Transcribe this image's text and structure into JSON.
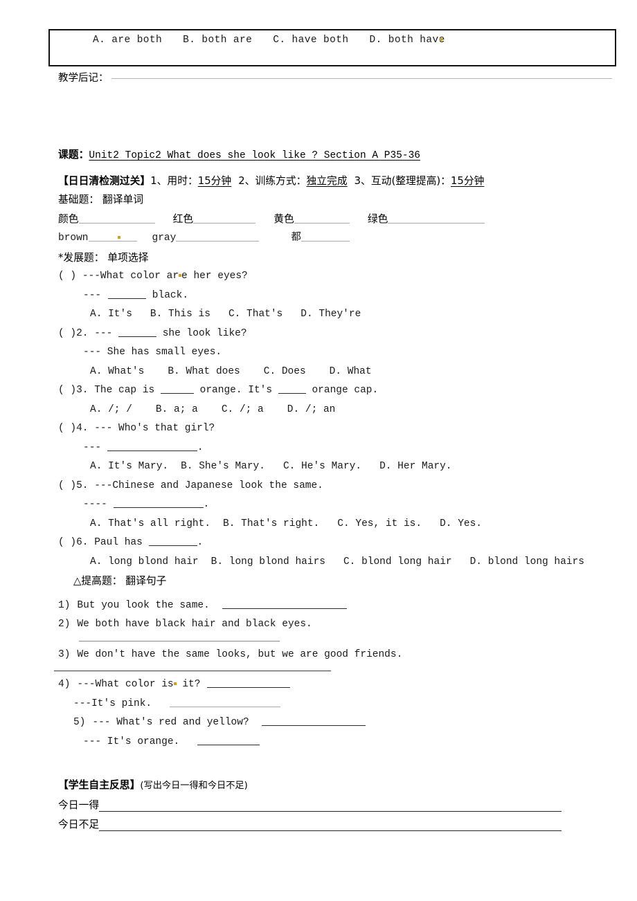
{
  "top_box": {
    "options": [
      "A. are both",
      "B. both are",
      "C. have both",
      "D. both have"
    ]
  },
  "teaching_note": {
    "label": "教学后记："
  },
  "lesson": {
    "title_label": "课题：",
    "title_value": "Unit2  Topic2   What does she look like  ?  Section A  P35-36"
  },
  "checkpoint": {
    "heading": "【日日清检测过关】",
    "item1_label": "1、用时：",
    "item1_value": "15分钟",
    "item2_label": "2、训练方式：",
    "item2_value": "独立完成",
    "item3_label": "3、互动(整理提高)：",
    "item3_value": "15分钟"
  },
  "basic": {
    "heading": "基础题：  翻译单词",
    "words_row1": [
      {
        "label": "颜色"
      },
      {
        "label": "红色"
      },
      {
        "label": "黄色"
      },
      {
        "label": "绿色"
      }
    ],
    "words_row2": [
      {
        "label": "brown"
      },
      {
        "label": "gray"
      },
      {
        "label": "都"
      }
    ]
  },
  "development": {
    "heading": "*发展题：  单项选择",
    "questions": [
      {
        "number": "(  ) ",
        "stem": "---What color ar",
        "stem_tail": "e her eyes?",
        "reply_prefix": "---",
        "reply_suffix": " black.",
        "options": [
          "A. It's",
          "B. This is",
          "C. That's",
          "D. They're"
        ]
      },
      {
        "number": "(  )2. ",
        "stem_prefix": "--- ",
        "stem_suffix": " she look like?",
        "reply": "--- She has small eyes.",
        "options": [
          "A. What's",
          "B. What does",
          "C. Does",
          "D. What"
        ]
      },
      {
        "number": "(  )3. ",
        "stem_a": "The cap is ",
        "stem_b": " orange. It's ",
        "stem_c": " orange cap.",
        "options": [
          "A. /; /",
          "B. a; a",
          "C. /; a",
          "D. /; an"
        ]
      },
      {
        "number": "(  )4. ",
        "stem": "--- Who's that girl?",
        "reply_prefix": "--- ",
        "reply_suffix": ".",
        "options": [
          "A. It's Mary.",
          "B. She's Mary.",
          "C. He's Mary.",
          "D. Her Mary."
        ]
      },
      {
        "number": "(  )5. ",
        "stem": "---Chinese and Japanese look the same.",
        "reply_prefix": "---- ",
        "reply_suffix": ".",
        "options": [
          "A. That's all right.",
          "B. That's right.",
          "C. Yes, it is.",
          "D. Yes."
        ]
      },
      {
        "number": "(  )6. ",
        "stem_prefix": "Paul has ",
        "stem_suffix": ".",
        "options": [
          "A. long blond hair",
          "B. long blond hairs",
          "C. blond long hair",
          "D. blond long hairs"
        ]
      }
    ]
  },
  "advanced": {
    "heading": "△提高题：  翻译句子",
    "sentences": [
      {
        "number": "1)",
        "text": "But you look the same."
      },
      {
        "number": "2)",
        "text": "We both have black hair and black eyes."
      },
      {
        "number": "3)",
        "text": "We don't have the same looks, but we are good friends."
      },
      {
        "number": "4)",
        "text": "---What color is",
        "text_tail": " it?",
        "reply": "---It's pink."
      },
      {
        "number": "5)",
        "text": "--- What's red and yellow?",
        "reply": "--- It's orange."
      }
    ]
  },
  "reflection": {
    "heading": "【学生自主反思】",
    "heading_note": "(写出今日一得和今日不足)",
    "row1_label": "今日一得",
    "row2_label": "今日不足"
  }
}
